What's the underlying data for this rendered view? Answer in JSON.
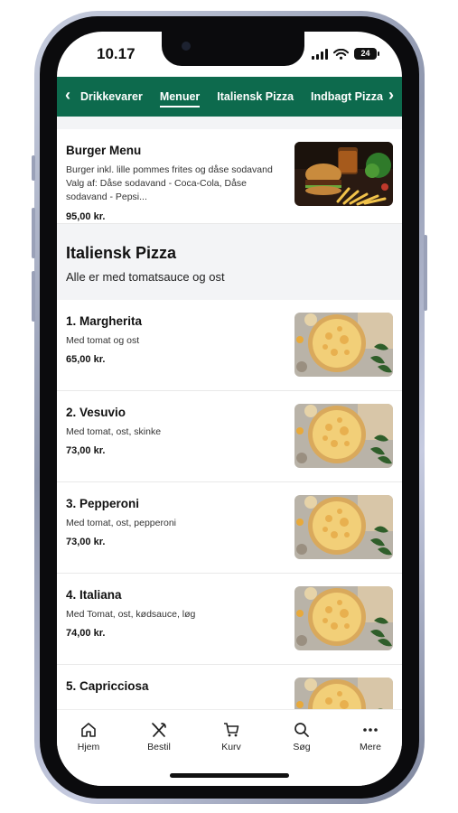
{
  "status": {
    "time": "10.17",
    "battery": "24"
  },
  "nav": {
    "tabs": [
      {
        "label": "Drikkevarer",
        "active": false
      },
      {
        "label": "Menuer",
        "active": true
      },
      {
        "label": "Italiensk Pizza",
        "active": false
      },
      {
        "label": "Indbagt Pizza",
        "active": false
      }
    ],
    "left_icon": "chevron-left-icon",
    "right_icon": "chevron-right-icon"
  },
  "burger": {
    "title": "Burger Menu",
    "desc": "Burger inkl. lille pommes frites og dåse sodavand Valg af: Dåse sodavand - Coca-Cola, Dåse sodavand - Pepsi...",
    "price": "95,00 kr."
  },
  "section": {
    "title": "Italiensk Pizza",
    "subtitle": "Alle er med tomatsauce og ost"
  },
  "pizzas": [
    {
      "title": "1. Margherita",
      "desc": "Med tomat og ost",
      "price": "65,00 kr."
    },
    {
      "title": "2. Vesuvio",
      "desc": "Med tomat, ost, skinke",
      "price": "73,00 kr."
    },
    {
      "title": "3. Pepperoni",
      "desc": "Med tomat, ost, pepperoni",
      "price": "73,00 kr."
    },
    {
      "title": "4. Italiana",
      "desc": "Med Tomat, ost, kødsauce, løg",
      "price": "74,00 kr."
    },
    {
      "title": "5. Capricciosa",
      "desc": "",
      "price": ""
    }
  ],
  "tabbar": {
    "items": [
      {
        "label": "Hjem",
        "icon": "home-icon"
      },
      {
        "label": "Bestil",
        "icon": "cutlery-icon"
      },
      {
        "label": "Kurv",
        "icon": "cart-icon"
      },
      {
        "label": "Søg",
        "icon": "search-icon"
      },
      {
        "label": "Mere",
        "icon": "more-icon"
      }
    ]
  },
  "colors": {
    "brand": "#0d6a4d",
    "section_bg": "#f3f4f6"
  }
}
